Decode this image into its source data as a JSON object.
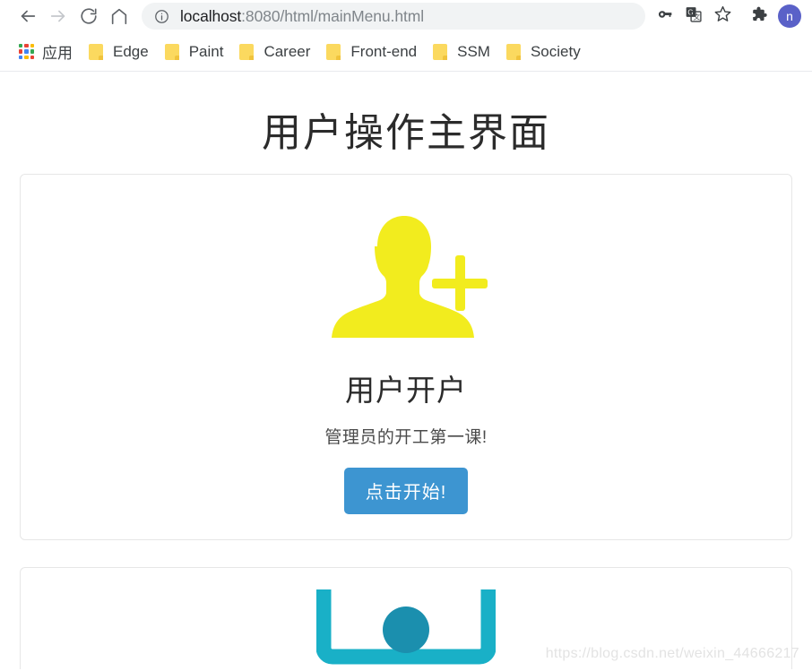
{
  "browser": {
    "nav": {
      "back_icon": "arrow-left-icon",
      "forward_icon": "arrow-right-icon",
      "reload_icon": "reload-icon",
      "home_icon": "home-icon"
    },
    "omnibox": {
      "info_icon": "site-info-icon",
      "url_host": "localhost",
      "url_path": ":8080/html/mainMenu.html",
      "url_full": "localhost:8080/html/mainMenu.html",
      "key_icon": "password-key-icon",
      "translate_icon": "translate-icon",
      "bookmark_icon": "star-bookmark-icon"
    },
    "extensions_icon": "puzzle-extensions-icon",
    "profile": {
      "avatar_icon": "profile-avatar",
      "initial": "n"
    },
    "bookmarks": {
      "apps_icon": "apps-grid-icon",
      "apps_label": "应用",
      "items": [
        {
          "icon": "folder-icon",
          "label": "Edge"
        },
        {
          "icon": "folder-icon",
          "label": "Paint"
        },
        {
          "icon": "folder-icon",
          "label": "Career"
        },
        {
          "icon": "folder-icon",
          "label": "Front-end"
        },
        {
          "icon": "folder-icon",
          "label": "SSM"
        },
        {
          "icon": "folder-icon",
          "label": "Society"
        }
      ]
    }
  },
  "page": {
    "title": "用户操作主界面",
    "cards": [
      {
        "icon": "add-user-icon",
        "icon_color": "#f2ec1e",
        "heading": "用户开户",
        "subtitle": "管理员的开工第一课!",
        "button_label": "点击开始!",
        "button_color": "#3d95d1"
      },
      {
        "icon": "monitor-screen-icon",
        "icon_color": "#19b0c7"
      }
    ],
    "watermark": "https://blog.csdn.net/weixin_44666217"
  }
}
